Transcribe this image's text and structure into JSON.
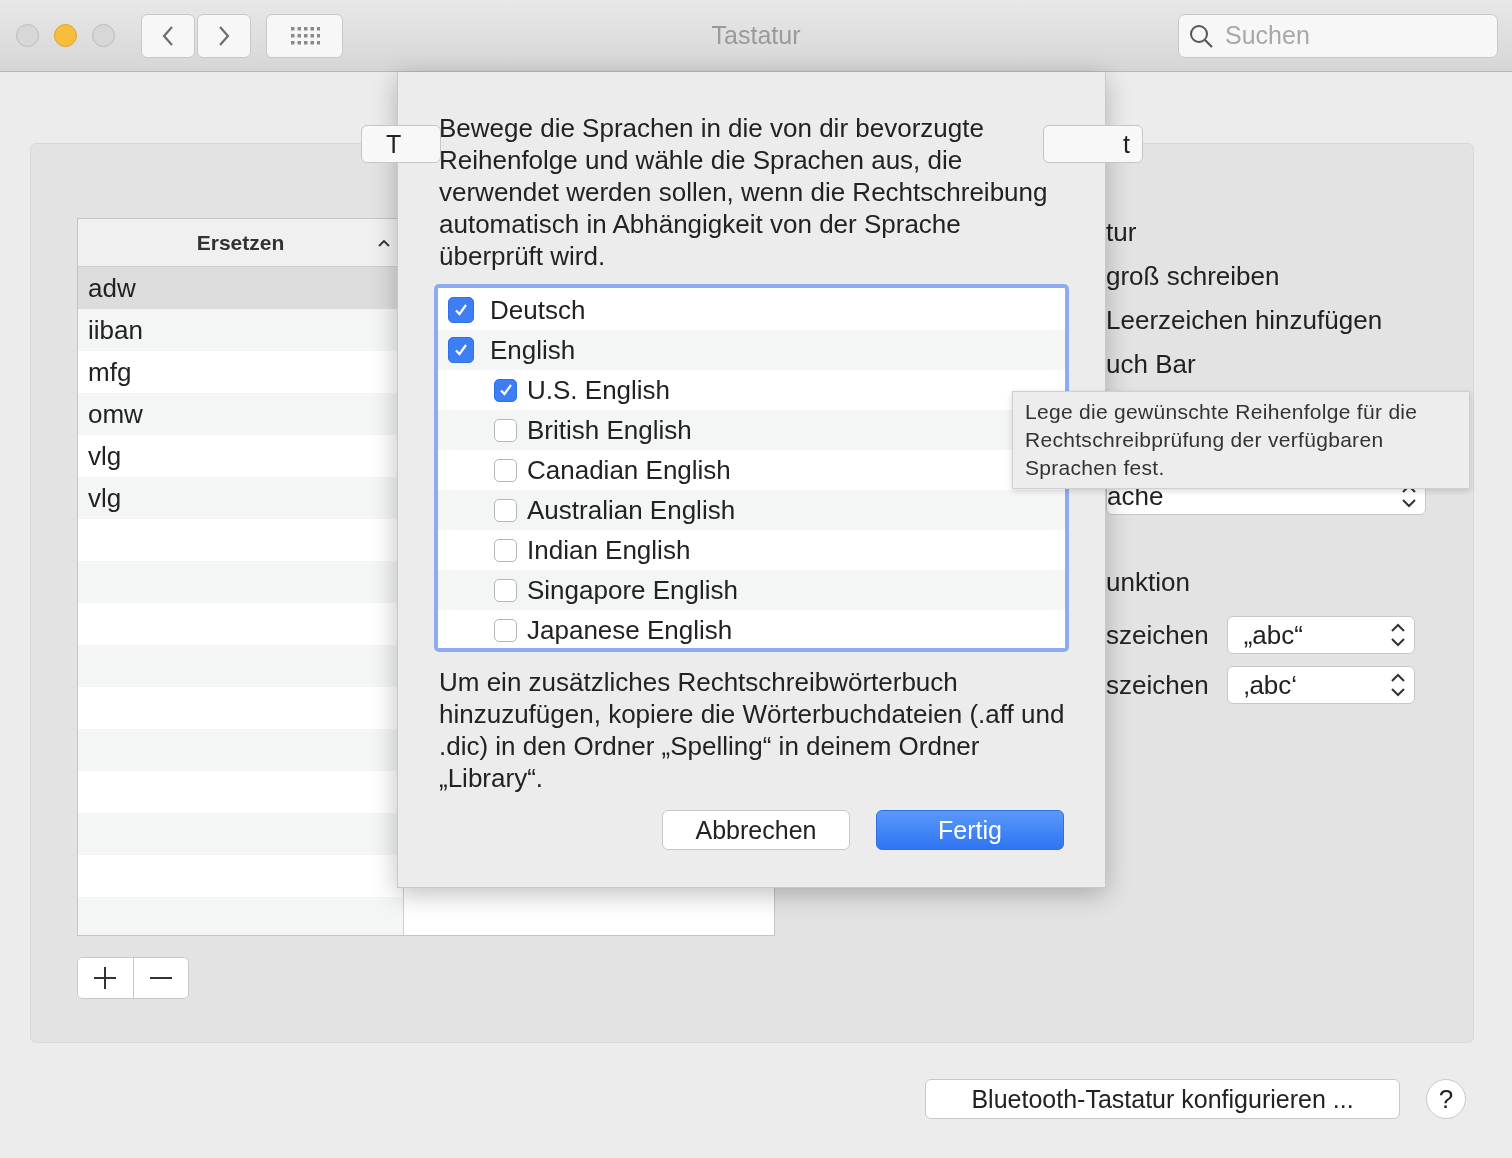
{
  "window": {
    "title": "Tastatur"
  },
  "search": {
    "placeholder": "Suchen"
  },
  "tabs": [
    {
      "label": "T",
      "selected": false
    },
    {
      "label": "t",
      "selected": false
    }
  ],
  "replacements": {
    "column": "Ersetzen",
    "rows": [
      {
        "text": "adw",
        "selected": true
      },
      {
        "text": "iiban",
        "selected": false
      },
      {
        "text": "mfg",
        "selected": false
      },
      {
        "text": "omw",
        "selected": false
      },
      {
        "text": "vlg",
        "selected": false
      },
      {
        "text": "vlg",
        "selected": false
      }
    ]
  },
  "settings": [
    {
      "kind": "label",
      "text": "tur"
    },
    {
      "kind": "label",
      "text": "groß schreiben"
    },
    {
      "kind": "label",
      "text": "Leerzeichen hinzufügen"
    },
    {
      "kind": "label",
      "text": "uch Bar"
    },
    {
      "kind": "wide-popup",
      "text": "ache"
    },
    {
      "kind": "section",
      "text": "unktion"
    },
    {
      "kind": "labeled-popup",
      "text": "szeichen",
      "value": "„abc“"
    },
    {
      "kind": "labeled-popup",
      "text": "szeichen",
      "value": "‚abc‘"
    }
  ],
  "sheet": {
    "message": "Bewege die Sprachen in die von dir bevorzugte Reihenfolge und wähle die Sprachen aus, die verwendet werden sollen, wenn die Rechtschreibung automatisch in Abhängigkeit von der Sprache überprüft wird.",
    "languages": [
      {
        "label": "Deutsch",
        "checked": true
      },
      {
        "label": "English",
        "checked": true,
        "children": [
          {
            "label": "U.S. English",
            "checked": true
          },
          {
            "label": "British English",
            "checked": false
          },
          {
            "label": "Canadian English",
            "checked": false
          },
          {
            "label": "Australian English",
            "checked": false
          },
          {
            "label": "Indian English",
            "checked": false
          },
          {
            "label": "Singapore English",
            "checked": false
          },
          {
            "label": "Japanese English",
            "checked": false
          }
        ]
      }
    ],
    "note": "Um ein zusätzliches Rechtschreibwörterbuch hinzuzufügen, kopiere die Wörterbuchdateien (.aff und .dic) in den Ordner „Spelling“ in deinem Ordner „Library“.",
    "buttons": [
      {
        "label": "Abbrechen",
        "default": false
      },
      {
        "label": "Fertig",
        "default": true
      }
    ]
  },
  "tooltip": {
    "text": "Lege die gewünschte Reihenfolge für die Rechtschreibprüfung der verfügbaren Sprachen fest."
  },
  "footer": {
    "button": "Bluetooth-Tastatur konfigurieren ...",
    "help": "?"
  }
}
